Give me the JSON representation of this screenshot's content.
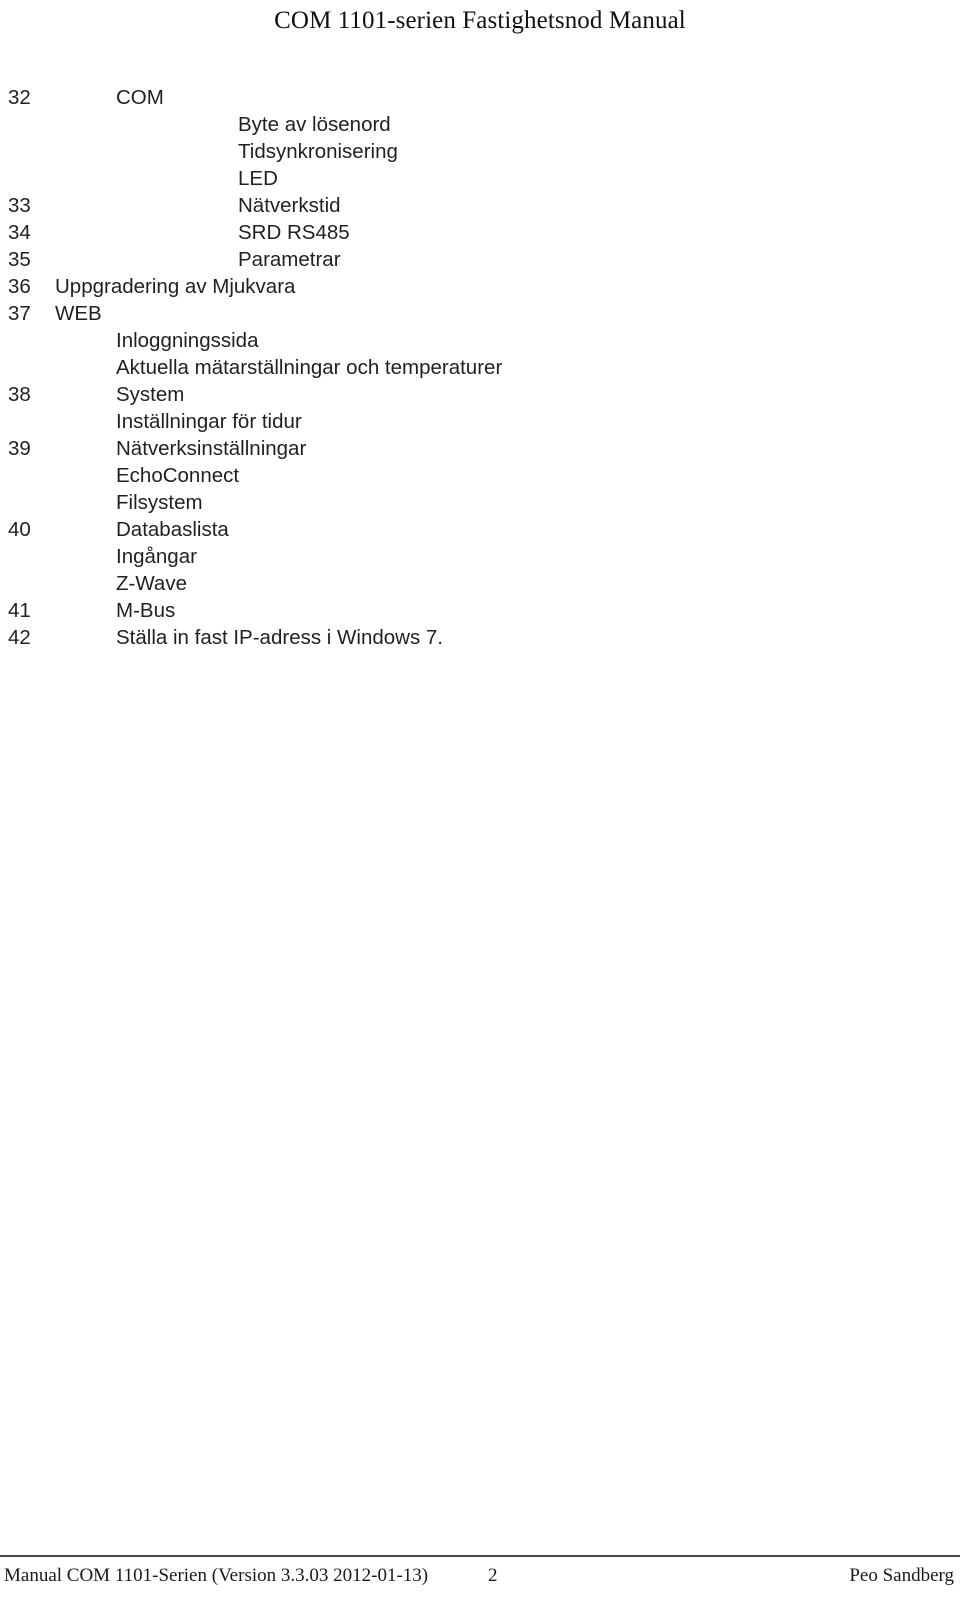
{
  "header": {
    "title": "COM 1101-serien Fastighetsnod Manual"
  },
  "toc": {
    "rows": [
      {
        "page": "32",
        "label": "COM",
        "level": 2
      },
      {
        "page": "",
        "label": "Byte av lösenord",
        "level": 3
      },
      {
        "page": "",
        "label": "Tidsynkronisering",
        "level": 3
      },
      {
        "page": "",
        "label": "LED",
        "level": 3
      },
      {
        "page": "33",
        "label": "Nätverkstid",
        "level": 3
      },
      {
        "page": "34",
        "label": "SRD RS485",
        "level": 3
      },
      {
        "page": "35",
        "label": "Parametrar",
        "level": 3
      },
      {
        "page": "36",
        "label": "Uppgradering av Mjukvara",
        "level": 1
      },
      {
        "page": "37",
        "label": "WEB",
        "level": 1
      },
      {
        "page": "",
        "label": "Inloggningssida",
        "level": 2
      },
      {
        "page": "",
        "label": "Aktuella mätarställningar och temperaturer",
        "level": 2
      },
      {
        "page": "38",
        "label": "System",
        "level": 2
      },
      {
        "page": "",
        "label": "Inställningar för tidur",
        "level": 2
      },
      {
        "page": "39",
        "label": "Nätverksinställningar",
        "level": 2
      },
      {
        "page": "",
        "label": "EchoConnect",
        "level": 2
      },
      {
        "page": "",
        "label": "Filsystem",
        "level": 2
      },
      {
        "page": "40",
        "label": "Databaslista",
        "level": 2
      },
      {
        "page": "",
        "label": "Ingångar",
        "level": 2
      },
      {
        "page": "",
        "label": "Z-Wave",
        "level": 2
      },
      {
        "page": "41",
        "label": "M-Bus",
        "level": 2
      },
      {
        "page": "42",
        "label": "Ställa in fast IP-adress i Windows 7.",
        "level": 2
      }
    ]
  },
  "footer": {
    "left": "Manual COM 1101-Serien (Version 3.3.03 2012-01-13)",
    "page_number": "2",
    "right": "Peo Sandberg"
  }
}
